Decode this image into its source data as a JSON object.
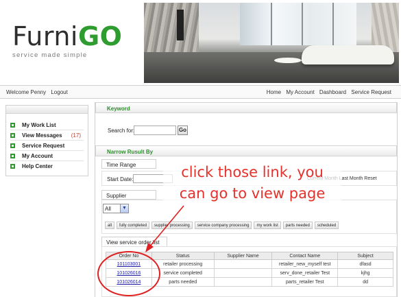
{
  "brand": {
    "name_part1": "Furni",
    "name_part2": "GO",
    "tagline_part1": "service made simple",
    "tagline_accent": ""
  },
  "topbar": {
    "welcome": "Welcome Penny",
    "logout": "Logout",
    "nav": [
      "Home",
      "My Account",
      "Dashboard",
      "Service Request"
    ]
  },
  "sidebar": {
    "items": [
      {
        "label": "My Work List",
        "count": ""
      },
      {
        "label": "View Messages",
        "count": "(17)"
      },
      {
        "label": "Service Request",
        "count": ""
      },
      {
        "label": "My Account",
        "count": ""
      },
      {
        "label": "Help Center",
        "count": ""
      }
    ]
  },
  "keyword": {
    "title": "Keyword",
    "search_label": "Search for:",
    "go_label": "Go"
  },
  "narrow": {
    "title": "Narrow Rusult By",
    "time_range_tab": "Time Range",
    "start_date_label": "Start Date:",
    "time_range_right": "Current Month  Last Month  Reset",
    "supplier_tab": "Supplier",
    "supplier_select": "All",
    "filters": [
      "all",
      "fully completed",
      "supplier processing",
      "service company processing",
      "my work list",
      "parts needed",
      "scheduled"
    ]
  },
  "order_list": {
    "tab_label": "View service order list",
    "columns": [
      "Order No",
      "Status",
      "Supplier Name",
      "Contact Name",
      "Subject"
    ],
    "rows": [
      {
        "order_no": "101103001",
        "status": "retailer processing",
        "supplier": "",
        "contact": "retailer_new_myself test",
        "subject": "dfasd"
      },
      {
        "order_no": "101026016",
        "status": "service completed",
        "supplier": "",
        "contact": "serv_done_retailer Test",
        "subject": "kjhg"
      },
      {
        "order_no": "101026014",
        "status": "parts needed",
        "supplier": "",
        "contact": "parts_retailer Test",
        "subject": "dd"
      }
    ]
  },
  "annotation": {
    "line1": "click those link, you",
    "line2": "can go to view page"
  },
  "colors": {
    "brand_green": "#2e9c2e",
    "annotation_red": "#e5312b",
    "link_blue": "#1a1aa6"
  }
}
